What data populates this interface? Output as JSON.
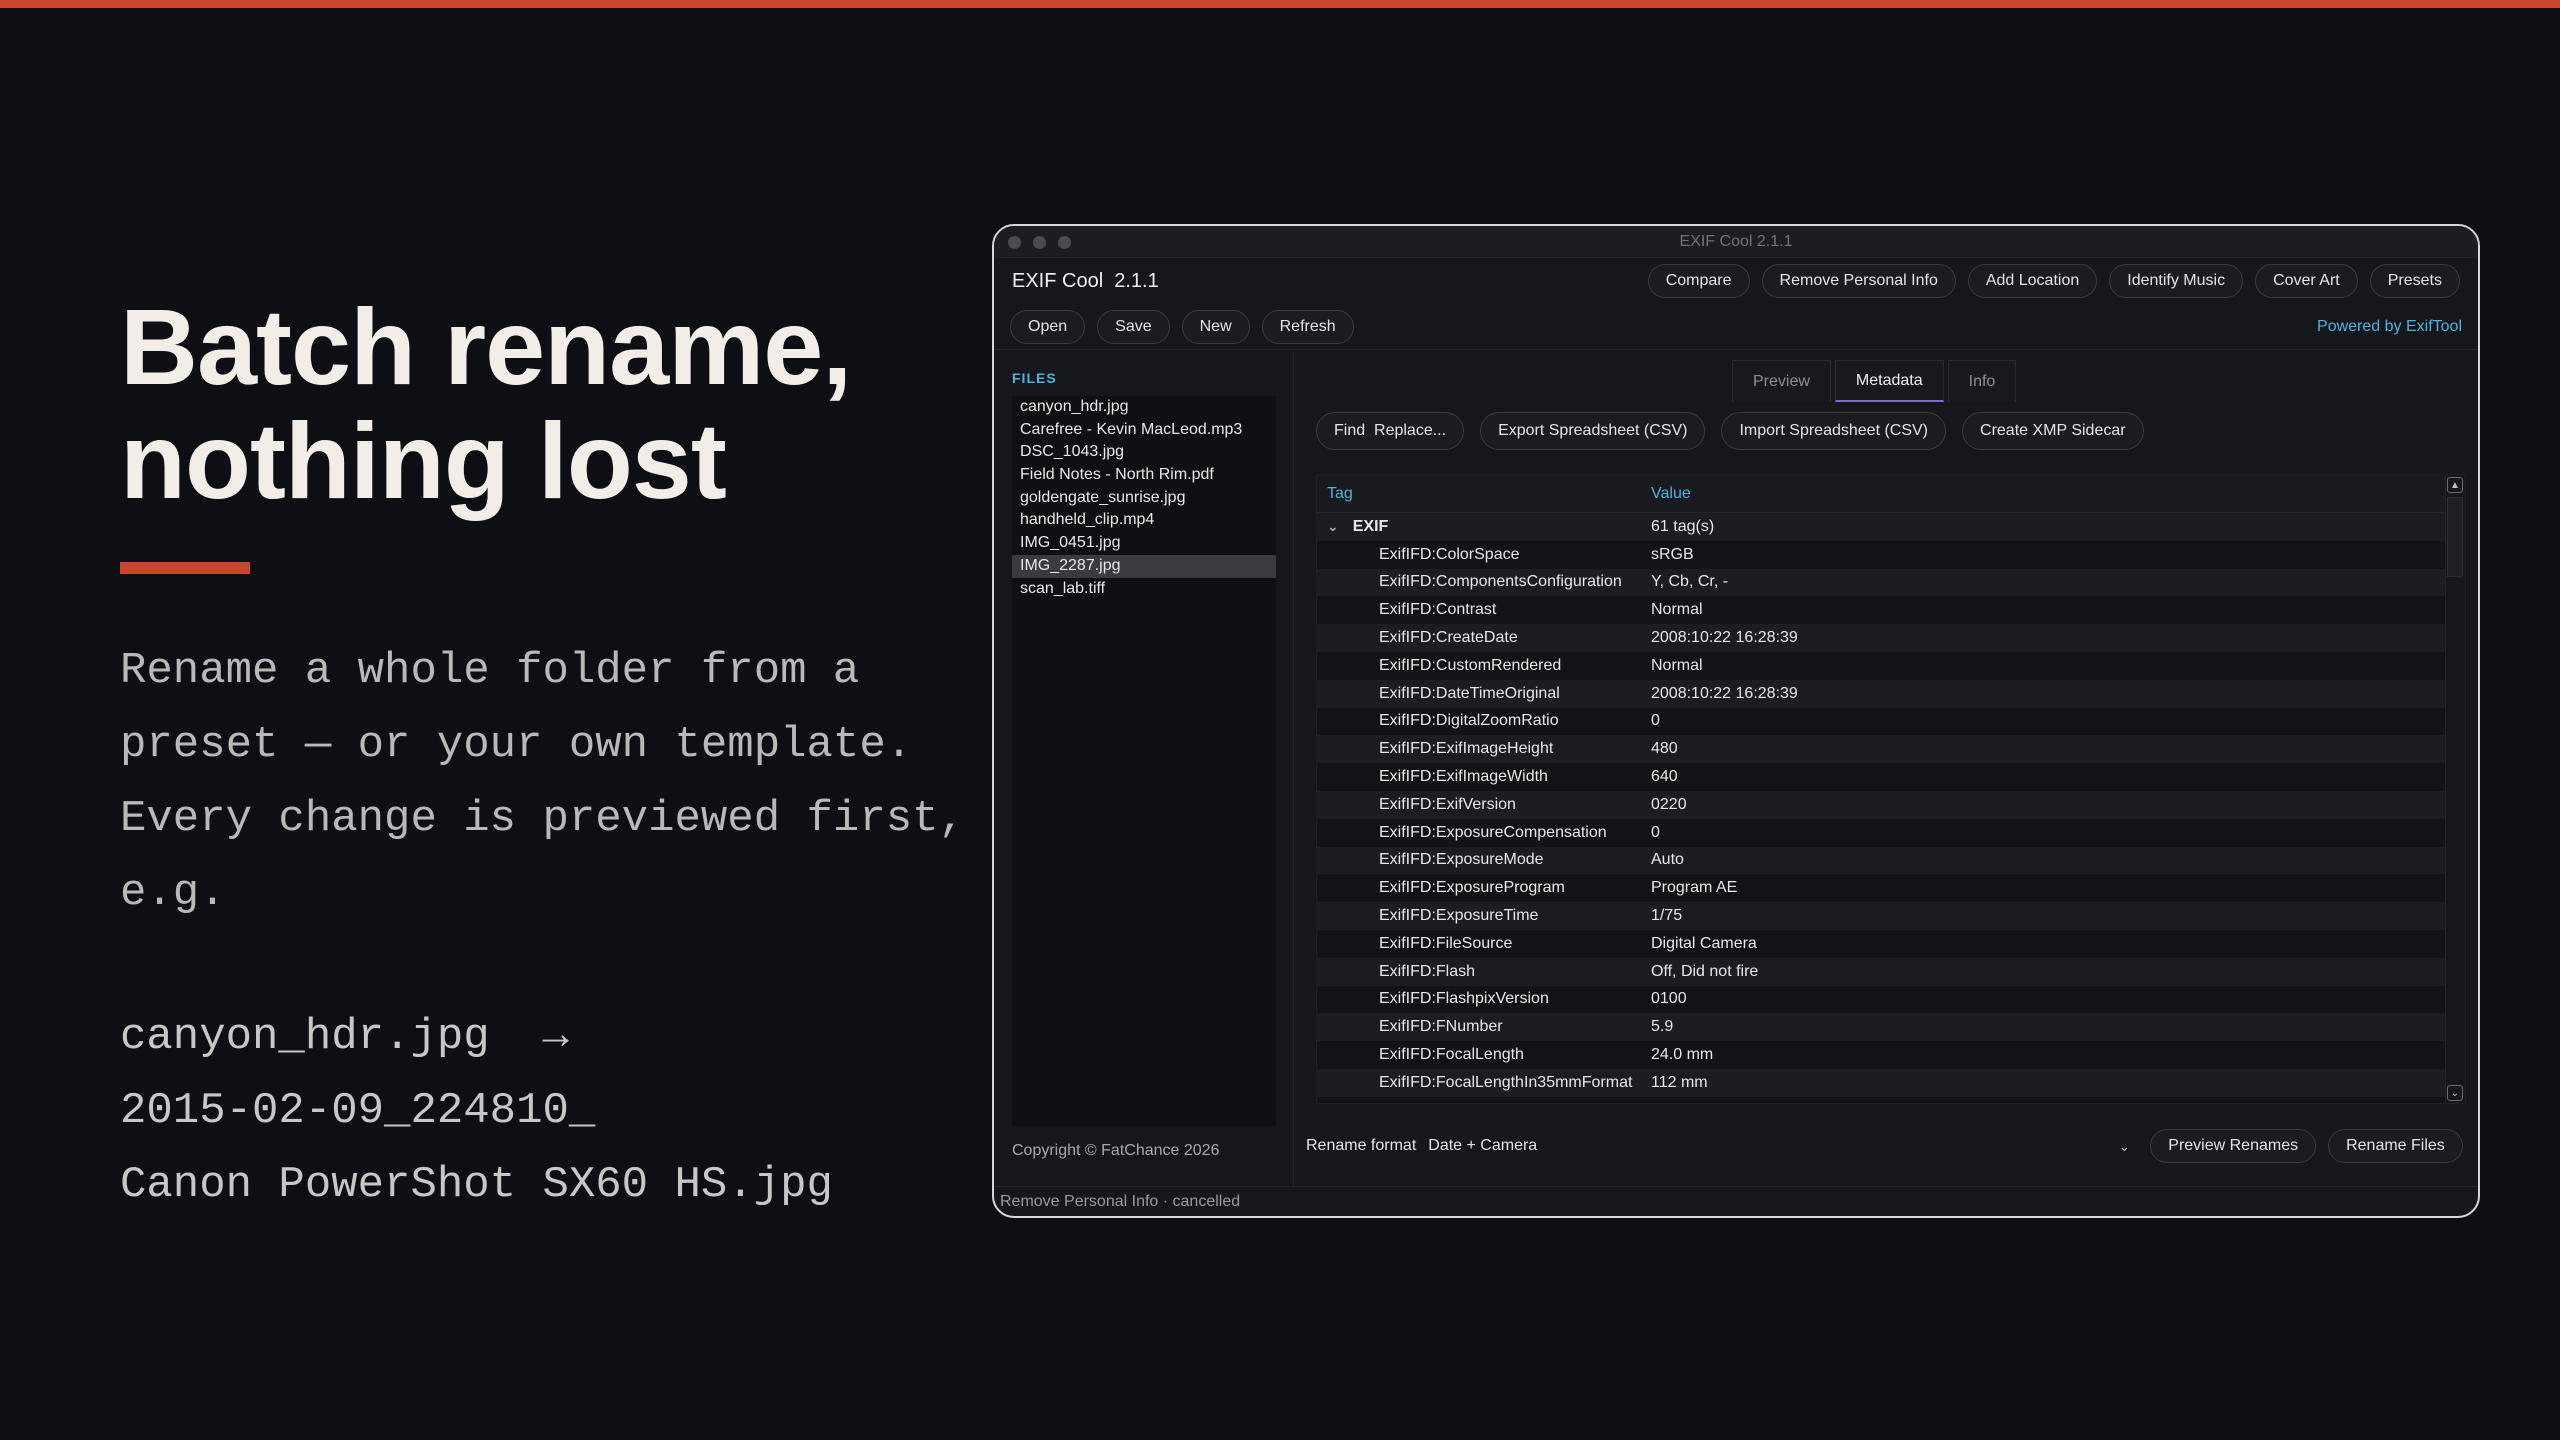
{
  "promo": {
    "headline_line1": "Batch rename,",
    "headline_line2": "nothing lost",
    "body_line1": "Rename a whole folder from a",
    "body_line2": "preset — or your own template.",
    "body_line3": "Every change is previewed first,",
    "body_line4": "e.g.",
    "example_line1": "canyon_hdr.jpg  →",
    "example_line2": "2015-02-09_224810_",
    "example_line3": "Canon PowerShot SX60 HS.jpg",
    "accent_color": "#c9472a"
  },
  "window": {
    "title": "EXIF Cool 2.1.1",
    "app_name": "EXIF Cool  2.1.1",
    "top_buttons": [
      "Compare",
      "Remove Personal Info",
      "Add Location",
      "Identify Music",
      "Cover Art",
      "Presets"
    ],
    "file_buttons": [
      "Open",
      "Save",
      "New",
      "Refresh"
    ],
    "powered_by": "Powered by ExifTool"
  },
  "files": {
    "title": "FILES",
    "items": [
      "canyon_hdr.jpg",
      "Carefree - Kevin MacLeod.mp3",
      "DSC_1043.jpg",
      "Field Notes - North Rim.pdf",
      "goldengate_sunrise.jpg",
      "handheld_clip.mp4",
      "IMG_0451.jpg",
      "IMG_2287.jpg",
      "scan_lab.tiff"
    ],
    "selected": "IMG_2287.jpg",
    "copyright": "Copyright © FatChance 2026"
  },
  "tabs": [
    "Preview",
    "Metadata",
    "Info"
  ],
  "active_tab": "Metadata",
  "actions": [
    "Find  Replace...",
    "Export Spreadsheet (CSV)",
    "Import Spreadsheet (CSV)",
    "Create XMP Sidecar"
  ],
  "table": {
    "col_tag": "Tag",
    "col_value": "Value",
    "group": {
      "name": "EXIF",
      "value": "61 tag(s)"
    },
    "rows": [
      [
        "ExifIFD:ColorSpace",
        "sRGB"
      ],
      [
        "ExifIFD:ComponentsConfiguration",
        "Y, Cb, Cr, -"
      ],
      [
        "ExifIFD:Contrast",
        "Normal"
      ],
      [
        "ExifIFD:CreateDate",
        "2008:10:22 16:28:39"
      ],
      [
        "ExifIFD:CustomRendered",
        "Normal"
      ],
      [
        "ExifIFD:DateTimeOriginal",
        "2008:10:22 16:28:39"
      ],
      [
        "ExifIFD:DigitalZoomRatio",
        "0"
      ],
      [
        "ExifIFD:ExifImageHeight",
        "480"
      ],
      [
        "ExifIFD:ExifImageWidth",
        "640"
      ],
      [
        "ExifIFD:ExifVersion",
        "0220"
      ],
      [
        "ExifIFD:ExposureCompensation",
        "0"
      ],
      [
        "ExifIFD:ExposureMode",
        "Auto"
      ],
      [
        "ExifIFD:ExposureProgram",
        "Program AE"
      ],
      [
        "ExifIFD:ExposureTime",
        "1/75"
      ],
      [
        "ExifIFD:FileSource",
        "Digital Camera"
      ],
      [
        "ExifIFD:Flash",
        "Off, Did not fire"
      ],
      [
        "ExifIFD:FlashpixVersion",
        "0100"
      ],
      [
        "ExifIFD:FNumber",
        "5.9"
      ],
      [
        "ExifIFD:FocalLength",
        "24.0 mm"
      ],
      [
        "ExifIFD:FocalLengthIn35mmFormat",
        "112 mm"
      ]
    ]
  },
  "rename": {
    "label": "Rename format",
    "value": "Date + Camera",
    "preview_button": "Preview Renames",
    "rename_button": "Rename Files"
  },
  "status": "Remove Personal Info · cancelled"
}
